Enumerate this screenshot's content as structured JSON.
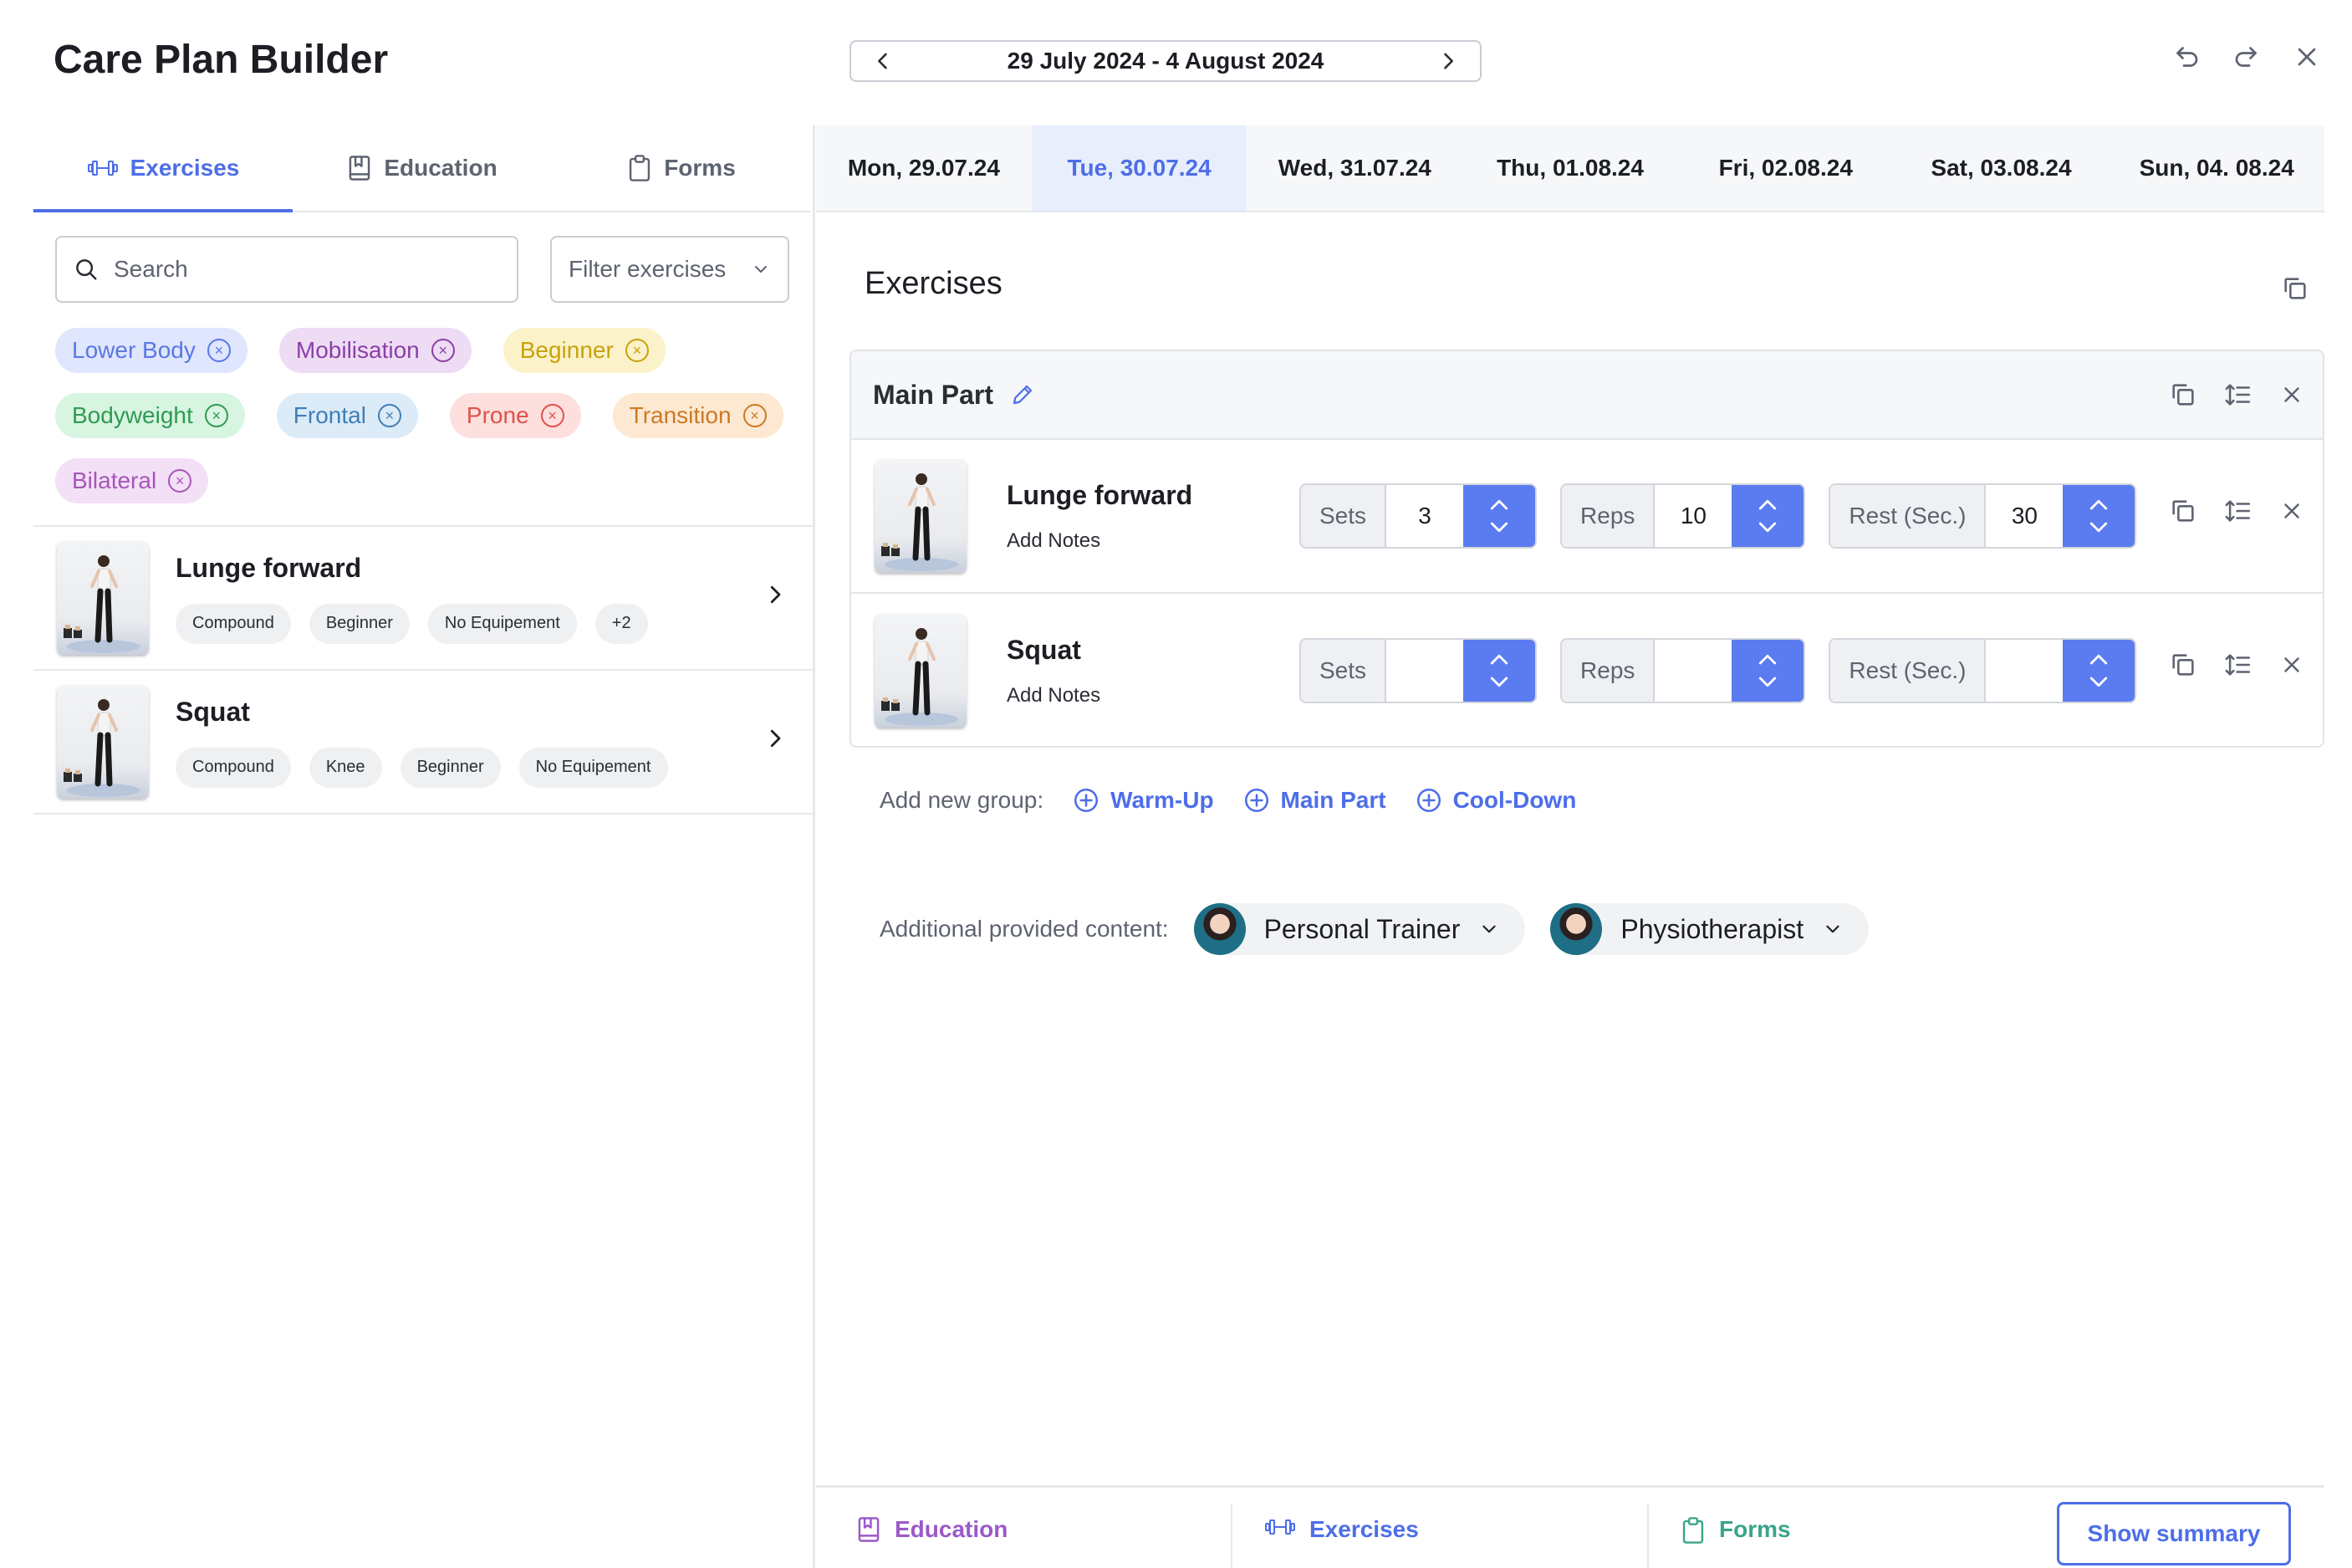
{
  "header": {
    "title": "Care Plan Builder",
    "date_range": "29 July 2024 - 4 August 2024"
  },
  "left_tabs": [
    {
      "label": "Exercises",
      "icon": "dumbbell-icon",
      "active": true
    },
    {
      "label": "Education",
      "icon": "book-icon",
      "active": false
    },
    {
      "label": "Forms",
      "icon": "clipboard-icon",
      "active": false
    }
  ],
  "search": {
    "placeholder": "Search",
    "value": ""
  },
  "filter": {
    "label": "Filter exercises"
  },
  "chips": [
    {
      "label": "Lower Body",
      "bg": "#dfe6fd",
      "fg": "#5a77e6"
    },
    {
      "label": "Mobilisation",
      "bg": "#eedcf4",
      "fg": "#8b3fa8"
    },
    {
      "label": "Beginner",
      "bg": "#fcf2c9",
      "fg": "#c8a10e"
    },
    {
      "label": "Bodyweight",
      "bg": "#d7f5e1",
      "fg": "#2f9a52"
    },
    {
      "label": "Frontal",
      "bg": "#dcebf8",
      "fg": "#3f7fb8"
    },
    {
      "label": "Prone",
      "bg": "#fde0de",
      "fg": "#e1504a"
    },
    {
      "label": "Transition",
      "bg": "#fde8d2",
      "fg": "#cc7a26"
    },
    {
      "label": "Bilateral",
      "bg": "#f3e0f6",
      "fg": "#a855b8"
    }
  ],
  "library": [
    {
      "name": "Lunge forward",
      "tags": [
        "Compound",
        "Beginner",
        "No Equipement",
        "+2"
      ]
    },
    {
      "name": "Squat",
      "tags": [
        "Compound",
        "Knee",
        "Beginner",
        "No Equipement"
      ]
    }
  ],
  "days": [
    {
      "label": "Mon, 29.07.24",
      "active": false
    },
    {
      "label": "Tue, 30.07.24",
      "active": true
    },
    {
      "label": "Wed, 31.07.24",
      "active": false
    },
    {
      "label": "Thu, 01.08.24",
      "active": false
    },
    {
      "label": "Fri, 02.08.24",
      "active": false
    },
    {
      "label": "Sat, 03.08.24",
      "active": false
    },
    {
      "label": "Sun, 04. 08.24",
      "active": false
    }
  ],
  "section": {
    "title": "Exercises"
  },
  "group": {
    "name": "Main Part",
    "exercises": [
      {
        "name": "Lunge forward",
        "notes": "Add Notes",
        "sets": "3",
        "reps": "10",
        "rest": "30"
      },
      {
        "name": "Squat",
        "notes": "Add Notes",
        "sets": "",
        "reps": "",
        "rest": ""
      }
    ]
  },
  "stepper_labels": {
    "sets": "Sets",
    "reps": "Reps",
    "rest": "Rest (Sec.)"
  },
  "add_group": {
    "label": "Add new group:",
    "options": [
      "Warm-Up",
      "Main Part",
      "Cool-Down"
    ]
  },
  "provided": {
    "label": "Additional provided content:",
    "providers": [
      "Personal Trainer",
      "Physiotherapist"
    ]
  },
  "bottom": {
    "education": "Education",
    "exercises": "Exercises",
    "forms": "Forms",
    "show_summary": "Show summary"
  },
  "colors": {
    "accent": "#4d6ee8",
    "stepper": "#5b7cf0",
    "education": "#9b59c9",
    "forms": "#3aa58a"
  }
}
